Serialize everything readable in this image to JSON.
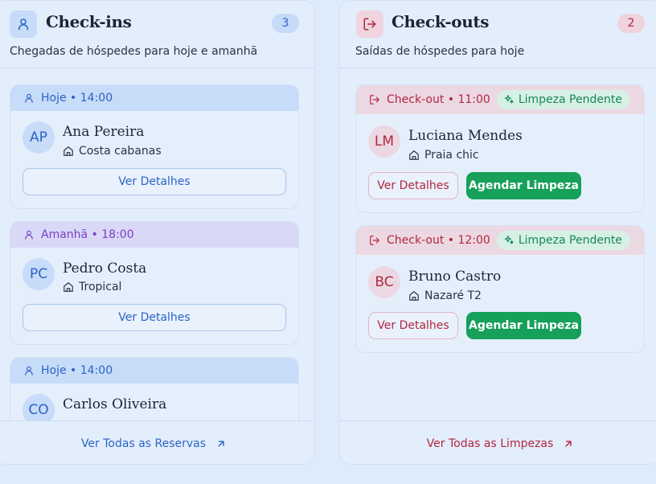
{
  "checkins": {
    "title": "Check-ins",
    "count": "3",
    "subtitle": "Chegadas de hóspedes para hoje e amanhã",
    "cards": [
      {
        "when": "Hoje • 14:00",
        "initials": "AP",
        "name": "Ana Pereira",
        "property": "Costa cabanas",
        "button": "Ver Detalhes"
      },
      {
        "when": "Amanhã • 18:00",
        "initials": "PC",
        "name": "Pedro Costa",
        "property": "Tropical",
        "button": "Ver Detalhes"
      },
      {
        "when": "Hoje • 14:00",
        "initials": "CO",
        "name": "Carlos Oliveira"
      }
    ],
    "footer_link": "Ver Todas as Reservas"
  },
  "checkouts": {
    "title": "Check-outs",
    "count": "2",
    "subtitle": "Saídas de hóspedes para hoje",
    "cards": [
      {
        "when": "Check-out • 11:00",
        "status": "Limpeza Pendente",
        "initials": "LM",
        "name": "Luciana Mendes",
        "property": "Praia chic",
        "details_button": "Ver Detalhes",
        "schedule_button": "Agendar Limpeza"
      },
      {
        "when": "Check-out • 12:00",
        "status": "Limpeza Pendente",
        "initials": "BC",
        "name": "Bruno Castro",
        "property": "Nazaré T2",
        "details_button": "Ver Detalhes",
        "schedule_button": "Agendar Limpeza"
      }
    ],
    "footer_link": "Ver Todas as Limpezas"
  },
  "colors": {
    "checkin_accent": "#2b63c6",
    "tomorrow_accent": "#7b3fc0",
    "checkout_accent": "#b3263f",
    "success": "#16a05a"
  },
  "icons": {
    "checkins": "user-icon",
    "checkouts": "log-out-icon",
    "property": "home-icon",
    "status": "sparkles-icon",
    "footer": "arrow-up-right-icon"
  }
}
